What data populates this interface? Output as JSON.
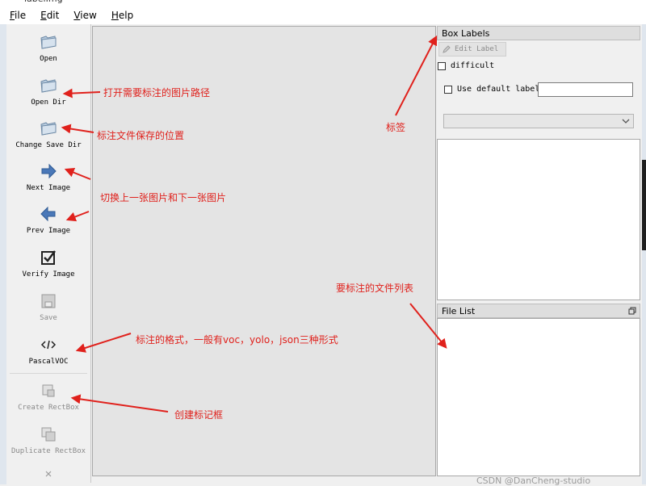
{
  "window": {
    "title": "labelImg"
  },
  "menu": [
    {
      "accel": "F",
      "rest": "ile"
    },
    {
      "accel": "E",
      "rest": "dit"
    },
    {
      "accel": "V",
      "rest": "iew"
    },
    {
      "accel": "H",
      "rest": "elp"
    }
  ],
  "toolbar": {
    "open": "Open",
    "open_dir": "Open Dir",
    "change_save_dir": "Change Save Dir",
    "next_image": "Next Image",
    "prev_image": "Prev Image",
    "verify_image": "Verify Image",
    "save": "Save",
    "format": "PascalVOC",
    "create_rectbox": "Create RectBox",
    "duplicate_rectbox": "Duplicate RectBox"
  },
  "box_labels": {
    "title": "Box Labels",
    "edit_label": "Edit Label",
    "difficult": "difficult",
    "use_default_label": "Use default label",
    "default_label_value": ""
  },
  "file_list": {
    "title": "File List"
  },
  "annotations": {
    "open_dir": "打开需要标注的图片路径",
    "save_dir": "标注文件保存的位置",
    "next_prev": "切换上一张图片和下一张图片",
    "format": "标注的格式，一般有voc，yolo，json三种形式",
    "create_box": "创建标记框",
    "labels": "标签",
    "file_list": "要标注的文件列表"
  },
  "watermark": "CSDN @DanCheng-studio",
  "colors": {
    "annotation": "#e0211c",
    "next_arrow": "#4a78b8"
  }
}
